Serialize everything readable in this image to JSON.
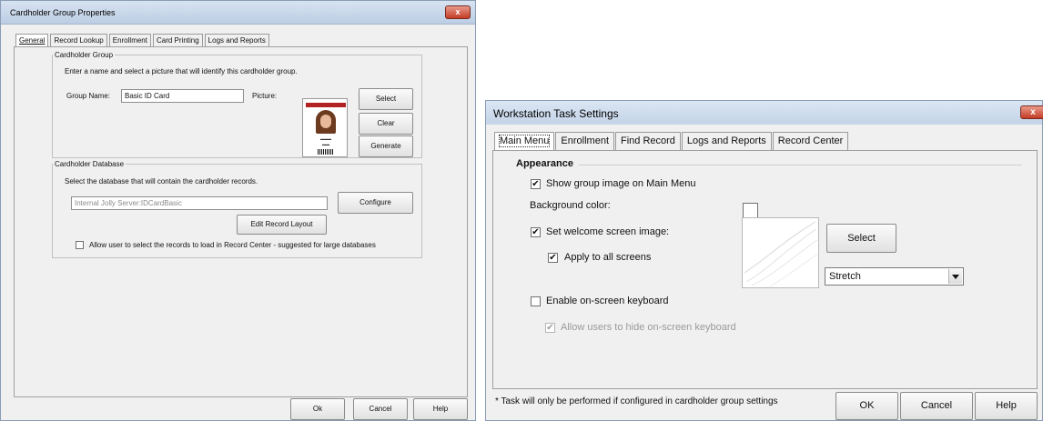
{
  "cardholder_dialog": {
    "title": "Cardholder Group Properties",
    "close_label": "x",
    "tabs": [
      {
        "label": "General",
        "active": true
      },
      {
        "label": "Record Lookup",
        "active": false
      },
      {
        "label": "Enrollment",
        "active": false
      },
      {
        "label": "Card Printing",
        "active": false
      },
      {
        "label": "Logs and Reports",
        "active": false
      }
    ],
    "group": {
      "legend": "Cardholder Group",
      "instruction": "Enter a name and select a picture that will identify this cardholder group.",
      "name_label": "Group Name:",
      "name_value": "Basic ID Card",
      "picture_label": "Picture:",
      "select_label": "Select",
      "clear_label": "Clear",
      "generate_label": "Generate"
    },
    "database": {
      "legend": "Cardholder Database",
      "instruction": "Select the database that will contain the cardholder records.",
      "path_value": "Internal Jolly Server:IDCardBasic",
      "configure_label": "Configure",
      "edit_layout_label": "Edit Record Layout",
      "allow_records_label": "Allow user to select the records to load in Record Center - suggested for large databases",
      "allow_records_checked": false
    },
    "ok_label": "Ok",
    "cancel_label": "Cancel",
    "help_label": "Help"
  },
  "workstation_dialog": {
    "title": "Workstation Task Settings",
    "close_label": "x",
    "tabs": [
      {
        "label": "Main Menu",
        "active": true
      },
      {
        "label": "Enrollment",
        "active": false
      },
      {
        "label": "Find Record",
        "active": false
      },
      {
        "label": "Logs and Reports",
        "active": false
      },
      {
        "label": "Record Center",
        "active": false
      }
    ],
    "appearance": {
      "heading": "Appearance",
      "show_group_image_label": "Show group image on Main Menu",
      "show_group_image_checked": true,
      "background_color_label": "Background color:",
      "welcome_image_label": "Set welcome screen image:",
      "welcome_image_checked": true,
      "apply_all_label": "Apply to all screens",
      "apply_all_checked": true,
      "select_label": "Select",
      "stretch_value": "Stretch",
      "onscreen_keyboard_label": "Enable on-screen keyboard",
      "onscreen_keyboard_checked": false,
      "hide_keyboard_label": "Allow users to hide on-screen keyboard",
      "hide_keyboard_checked": true,
      "hide_keyboard_enabled": false
    },
    "footnote": "* Task will only be performed if configured in cardholder group settings",
    "ok_label": "OK",
    "cancel_label": "Cancel",
    "help_label": "Help"
  }
}
